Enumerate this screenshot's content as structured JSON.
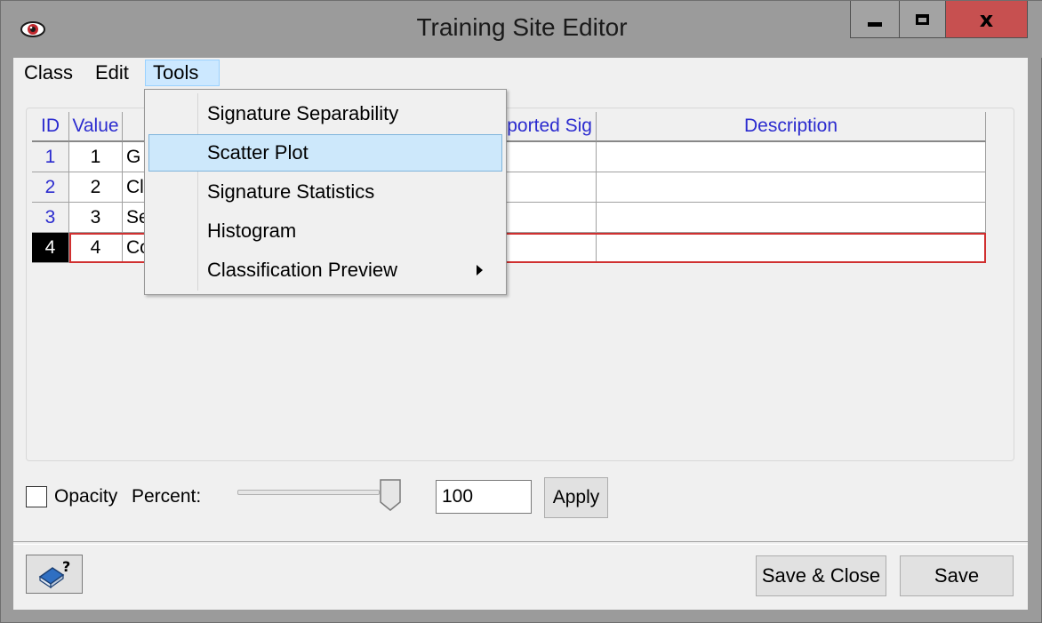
{
  "window": {
    "title": "Training Site Editor"
  },
  "menubar": {
    "class_label": "Class",
    "edit_label": "Edit",
    "tools_label": "Tools"
  },
  "tools_menu": {
    "items": [
      {
        "label": "Signature Separability",
        "has_submenu": false
      },
      {
        "label": "Scatter Plot",
        "has_submenu": false,
        "highlighted": true
      },
      {
        "label": "Signature Statistics",
        "has_submenu": false
      },
      {
        "label": "Histogram",
        "has_submenu": false
      },
      {
        "label": "Classification Preview",
        "has_submenu": true
      }
    ]
  },
  "table": {
    "headers": {
      "id": "ID",
      "value": "Value",
      "imported_sig": "nported Sig",
      "description": "Description"
    },
    "rows": [
      {
        "id": "1",
        "value": "1",
        "name": "G",
        "imported_sig": "",
        "description": ""
      },
      {
        "id": "2",
        "value": "2",
        "name": "Cl",
        "imported_sig": "",
        "description": ""
      },
      {
        "id": "3",
        "value": "3",
        "name": "Se",
        "imported_sig": "",
        "description": ""
      },
      {
        "id": "4",
        "value": "4",
        "name": "Co",
        "imported_sig": "",
        "description": "",
        "selected": true
      }
    ]
  },
  "opacity": {
    "checkbox_label": "Opacity",
    "percent_label": "Percent:",
    "slider_value_percent": 100,
    "input_value": "100",
    "apply_label": "Apply",
    "checked": false
  },
  "footer": {
    "save_close_label": "Save & Close",
    "save_label": "Save"
  },
  "colors": {
    "titlebar": "#9b9b9b",
    "close_button": "#c75050",
    "header_text": "#2b2bcf",
    "selected_row_border": "#d03030",
    "menu_highlight": "#cde8fb"
  }
}
